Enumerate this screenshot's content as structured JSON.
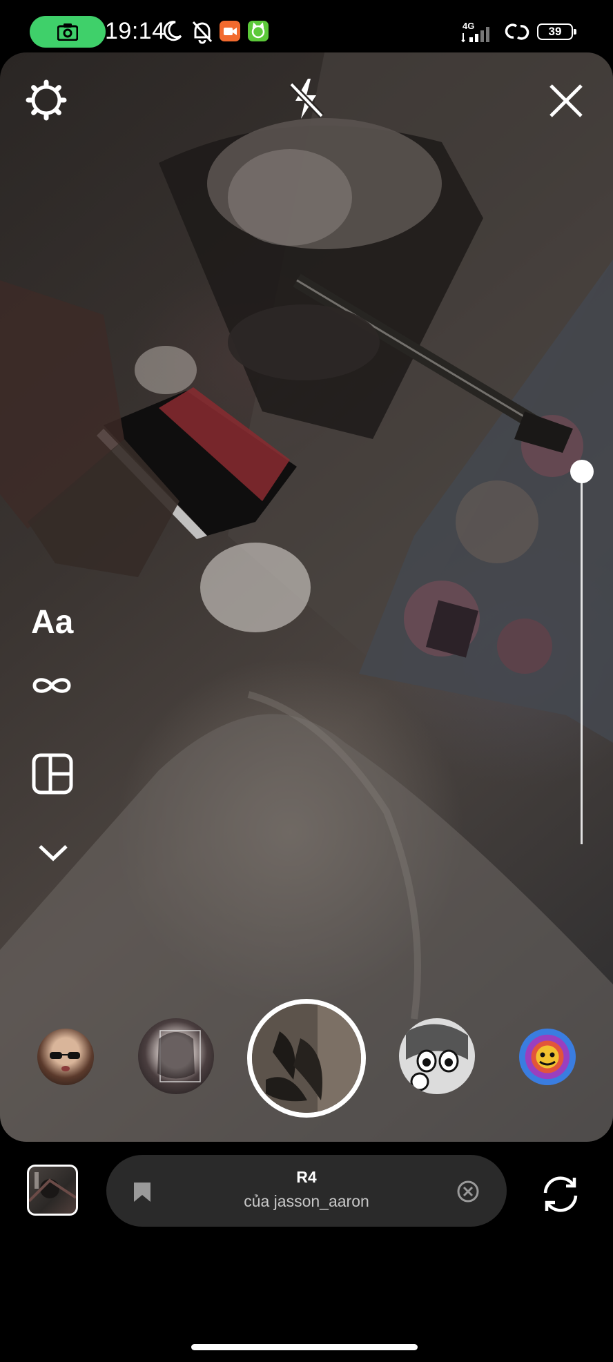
{
  "status_bar": {
    "time": "19:14",
    "network": "4G",
    "battery": "39",
    "camera_pill_color": "#3fd06a",
    "icons": [
      "camera-icon",
      "moon-icon",
      "bell-off-icon",
      "video-app-icon",
      "cat-app-icon",
      "signal-icon",
      "link-icon",
      "battery-icon"
    ]
  },
  "camera": {
    "settings_icon": "gear-icon",
    "flash_icon": "flash-off-icon",
    "close_icon": "close-icon",
    "tools": {
      "text_label": "Aa",
      "boomerang_icon": "infinity-icon",
      "layout_icon": "layout-icon",
      "more_icon": "chevron-down-icon"
    },
    "zoom_level": 1.0
  },
  "effects": {
    "items": [
      "effect-1",
      "effect-2",
      "effect-3",
      "effect-4"
    ],
    "selected": "capture"
  },
  "bottom_bar": {
    "music_title": "R4",
    "music_subtitle": "của jasson_aaron",
    "bookmark_icon": "bookmark-icon",
    "remove_icon": "close-circle-icon",
    "flip_icon": "camera-flip-icon"
  }
}
